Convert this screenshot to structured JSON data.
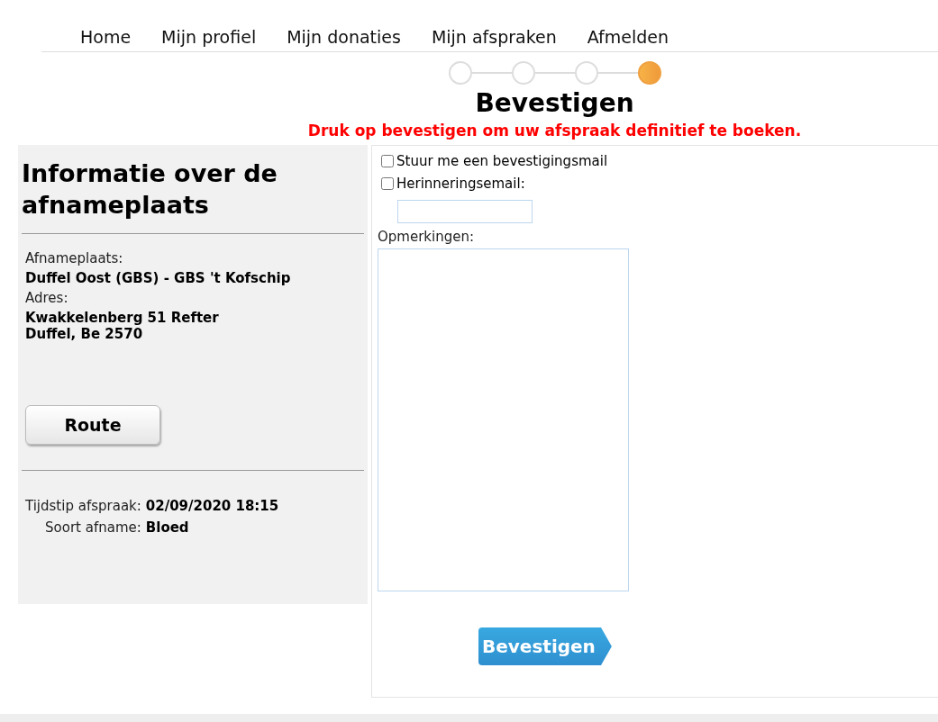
{
  "nav": {
    "items": [
      {
        "label": "Home"
      },
      {
        "label": "Mijn profiel"
      },
      {
        "label": "Mijn donaties"
      },
      {
        "label": "Mijn afspraken"
      },
      {
        "label": "Afmelden"
      }
    ]
  },
  "steps": [
    {
      "selected": false
    },
    {
      "selected": false
    },
    {
      "selected": false
    },
    {
      "selected": true
    }
  ],
  "title": "Bevestigen",
  "instruction": "Druk op bevestigen om uw afspraak definitief te boeken.",
  "info": {
    "heading": "Informatie over de afnameplaats",
    "place_label": "Afnameplaats:",
    "place": "Duffel Oost (GBS) - GBS 't Kofschip",
    "address_label": "Adres:",
    "address_lines": [
      "Kwakkelenberg 51 Refter",
      "Duffel, Be 2570"
    ],
    "route_button": "Route",
    "details": [
      {
        "label": "Tijdstip afspraak:",
        "value": "02/09/2020 18:15"
      },
      {
        "label": "Soort afname:",
        "value": "Bloed"
      }
    ]
  },
  "form": {
    "confirm_mail": {
      "label": "Stuur me een bevestigingsmail",
      "checked": false
    },
    "reminder": {
      "label": "Herinneringsemail:",
      "checked": false
    },
    "remarks_label": "Opmerkingen:",
    "submit": "Bevestigen"
  }
}
